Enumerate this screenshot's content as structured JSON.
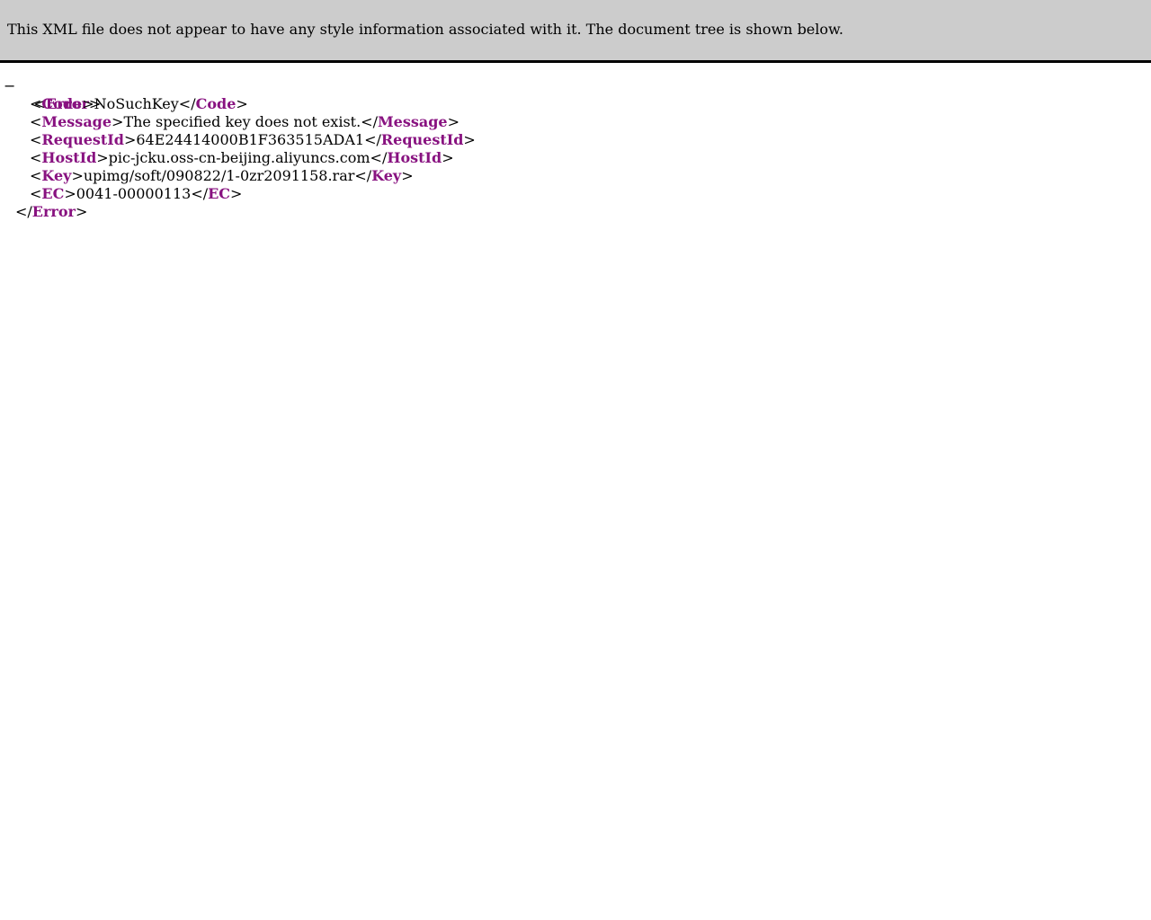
{
  "banner": {
    "message": "This XML file does not appear to have any style information associated with it. The document tree is shown below."
  },
  "tree": {
    "toggle": "−",
    "lt": "<",
    "lt_close": "</",
    "gt": ">",
    "root_tag": "Error",
    "children": [
      {
        "tag": "Code",
        "value": "NoSuchKey"
      },
      {
        "tag": "Message",
        "value": "The specified key does not exist."
      },
      {
        "tag": "RequestId",
        "value": "64E24414000B1F363515ADA1"
      },
      {
        "tag": "HostId",
        "value": "pic-jcku.oss-cn-beijing.aliyuncs.com"
      },
      {
        "tag": "Key",
        "value": "upimg/soft/090822/1-0zr2091158.rar"
      },
      {
        "tag": "EC",
        "value": "0041-00000113"
      }
    ]
  },
  "colors": {
    "tag_name": "#881280",
    "banner_bg": "#cccccc"
  }
}
